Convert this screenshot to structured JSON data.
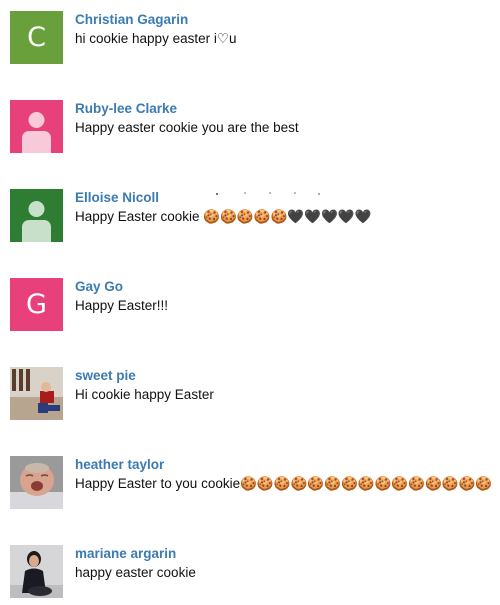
{
  "comments": [
    {
      "author": "Christian Gagarin",
      "text": "hi cookie happy easter i♡u",
      "avatar": {
        "type": "letter",
        "letter": "C",
        "color": "#6aa03c"
      }
    },
    {
      "author": "Ruby-lee Clarke",
      "text": "Happy easter cookie you are the best",
      "avatar": {
        "type": "silhouette",
        "color": "#e8407a"
      }
    },
    {
      "author": "Elloise Nicoll",
      "text": "Happy Easter  cookie 🍪🍪🍪🍪🍪🖤🖤🖤🖤🖤",
      "avatar": {
        "type": "silhouette",
        "color": "#2e7d32"
      }
    },
    {
      "author": "Gay Go",
      "text": "Happy Easter!!!",
      "avatar": {
        "type": "letter",
        "letter": "G",
        "color": "#e8407a"
      }
    },
    {
      "author": "sweet pie",
      "text": "Hi cookie happy Easter",
      "avatar": {
        "type": "photo",
        "subject": "child-on-floor-photo"
      }
    },
    {
      "author": "heather taylor",
      "text": "Happy Easter to you cookie🍪🍪🍪🍪🍪🍪🍪🍪🍪🍪🍪🍪🍪🍪🍪",
      "avatar": {
        "type": "photo",
        "subject": "crying-baby-photo"
      }
    },
    {
      "author": "mariane argarin",
      "text": "happy easter cookie",
      "avatar": {
        "type": "photo",
        "subject": "woman-sitting-photo"
      }
    }
  ]
}
